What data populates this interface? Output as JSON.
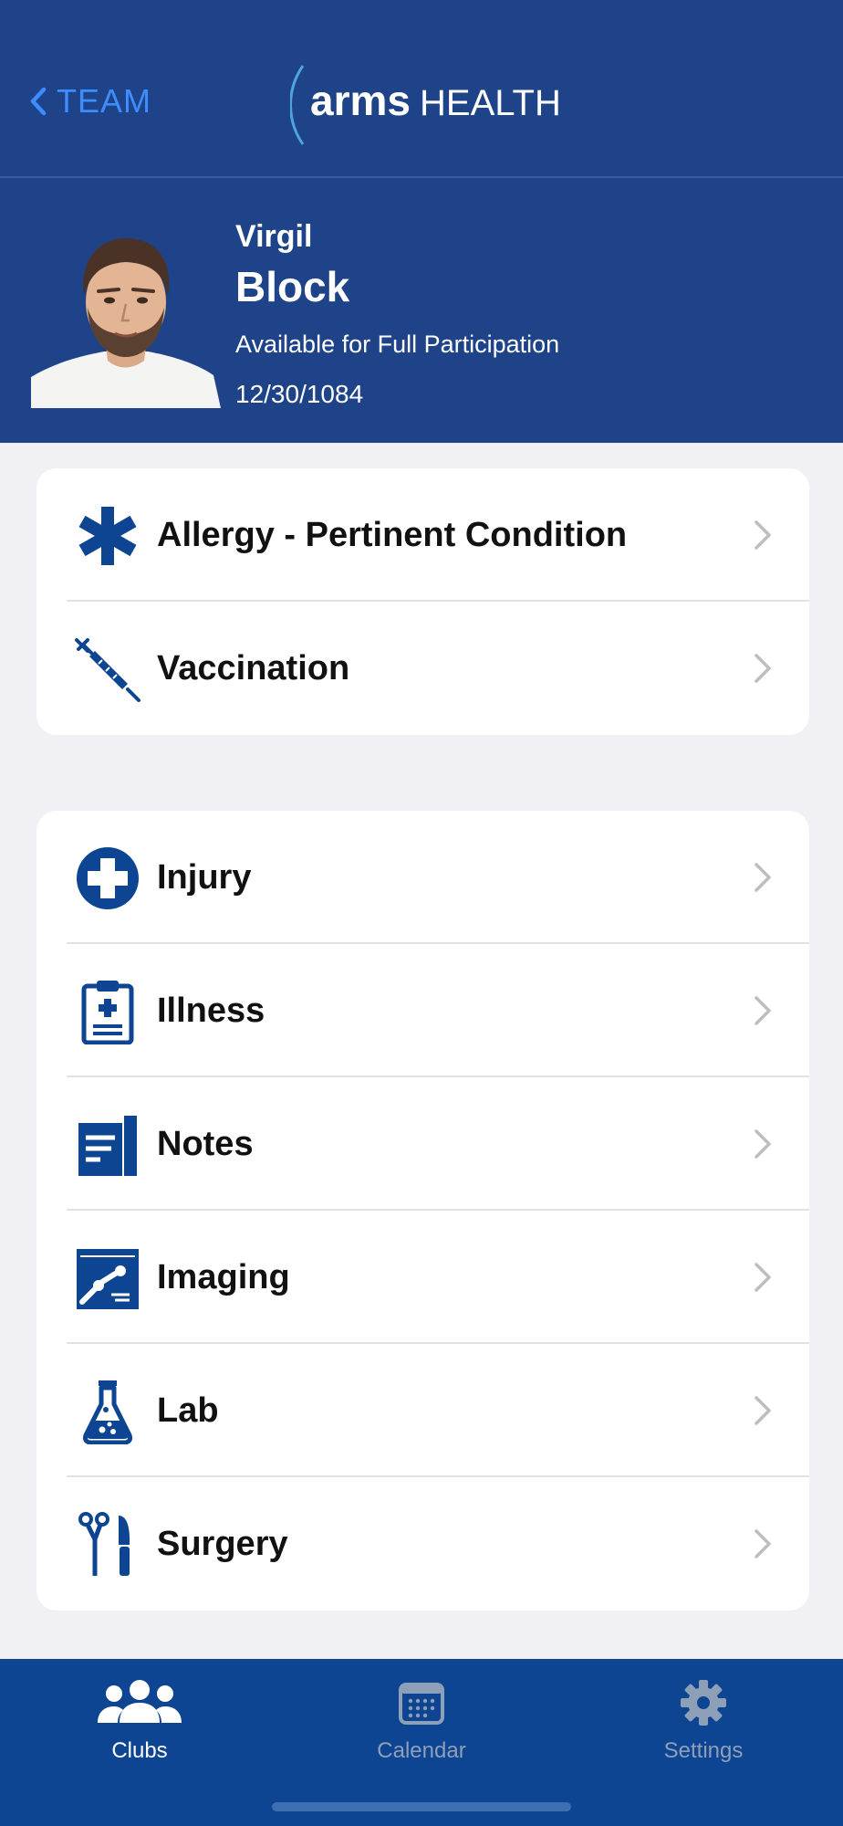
{
  "header": {
    "back_label": "TEAM",
    "logo_bold": "arms",
    "logo_light": "HEALTH",
    "accent": "#1E4389"
  },
  "profile": {
    "first_name": "Virgil",
    "last_name": "Block",
    "status": "Available for Full Participation",
    "date": "12/30/1084"
  },
  "group1": [
    {
      "label": "Allergy - Pertinent Condition",
      "icon": "asterisk-icon"
    },
    {
      "label": "Vaccination",
      "icon": "syringe-icon"
    }
  ],
  "group2": [
    {
      "label": "Injury",
      "icon": "plus-circle-icon"
    },
    {
      "label": "Illness",
      "icon": "clipboard-icon"
    },
    {
      "label": "Notes",
      "icon": "notes-icon"
    },
    {
      "label": "Imaging",
      "icon": "xray-icon"
    },
    {
      "label": "Lab",
      "icon": "flask-icon"
    },
    {
      "label": "Surgery",
      "icon": "surgical-tools-icon"
    }
  ],
  "tabs": [
    {
      "label": "Clubs",
      "icon": "people-icon",
      "active": true
    },
    {
      "label": "Calendar",
      "icon": "calendar-icon",
      "active": false
    },
    {
      "label": "Settings",
      "icon": "gear-icon",
      "active": false
    }
  ]
}
